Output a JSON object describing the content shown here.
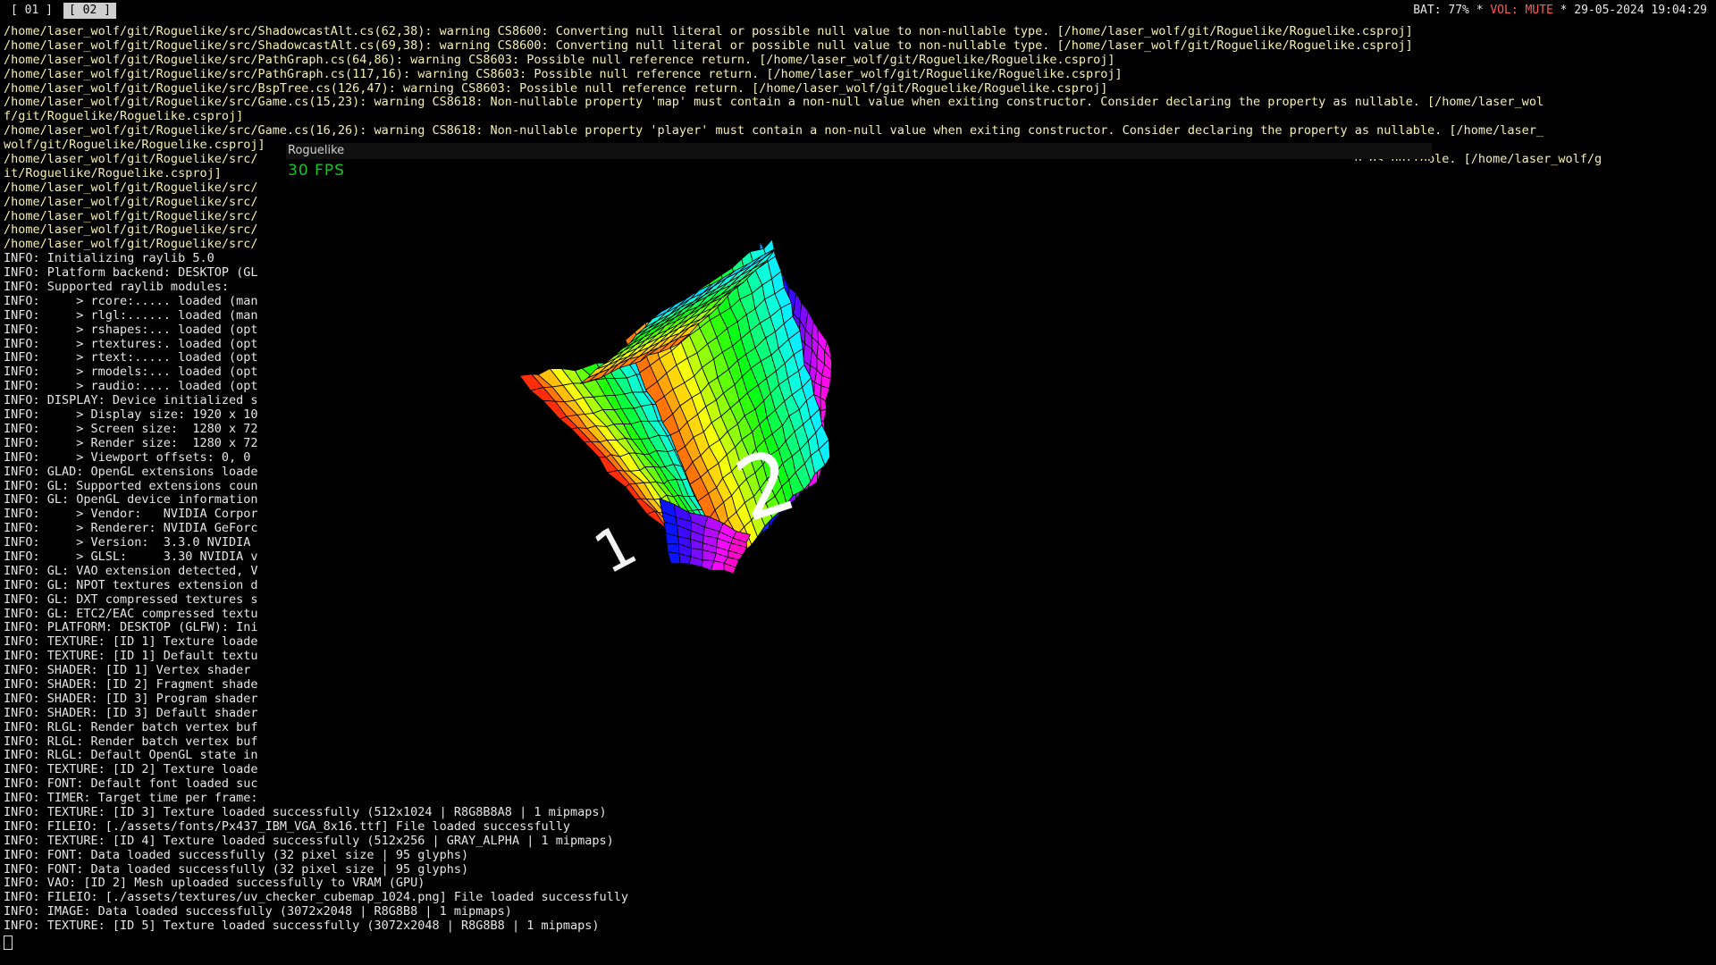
{
  "topbar": {
    "workspaces": [
      "[ 01 ]",
      "[ 02 ]"
    ],
    "battery": "BAT: 77%",
    "sep": "*",
    "volume": "VOL: MUTE",
    "datetime": "29-05-2024 19:04:29"
  },
  "terminal": {
    "lines": [
      "/home/laser_wolf/git/Roguelike/src/ShadowcastAlt.cs(62,38): warning CS8600: Converting null literal or possible null value to non-nullable type. [/home/laser_wolf/git/Roguelike/Roguelike.csproj]",
      "/home/laser_wolf/git/Roguelike/src/ShadowcastAlt.cs(69,38): warning CS8600: Converting null literal or possible null value to non-nullable type. [/home/laser_wolf/git/Roguelike/Roguelike.csproj]",
      "/home/laser_wolf/git/Roguelike/src/PathGraph.cs(64,86): warning CS8603: Possible null reference return. [/home/laser_wolf/git/Roguelike/Roguelike.csproj]",
      "/home/laser_wolf/git/Roguelike/src/PathGraph.cs(117,16): warning CS8603: Possible null reference return. [/home/laser_wolf/git/Roguelike/Roguelike.csproj]",
      "/home/laser_wolf/git/Roguelike/src/BspTree.cs(126,47): warning CS8603: Possible null reference return. [/home/laser_wolf/git/Roguelike/Roguelike.csproj]",
      "/home/laser_wolf/git/Roguelike/src/Game.cs(15,23): warning CS8618: Non-nullable property 'map' must contain a non-null value when exiting constructor. Consider declaring the property as nullable. [/home/laser_wol",
      "f/git/Roguelike/Roguelike.csproj]",
      "/home/laser_wolf/git/Roguelike/src/Game.cs(16,26): warning CS8618: Non-nullable property 'player' must contain a non-null value when exiting constructor. Consider declaring the property as nullable. [/home/laser_",
      "wolf/git/Roguelike/Roguelike.csproj]",
      "/home/laser_wolf/git/Roguelike/src/                                                                                                                                                       d as nullable. [/home/laser_wolf/g",
      "it/Roguelike/Roguelike.csproj]",
      "/home/laser_wolf/git/Roguelike/src/",
      "/home/laser_wolf/git/Roguelike/src/",
      "/home/laser_wolf/git/Roguelike/src/",
      "/home/laser_wolf/git/Roguelike/src/",
      "/home/laser_wolf/git/Roguelike/src/",
      "INFO: Initializing raylib 5.0",
      "INFO: Platform backend: DESKTOP (GL",
      "INFO: Supported raylib modules:",
      "INFO:     > rcore:..... loaded (man",
      "INFO:     > rlgl:...... loaded (man",
      "INFO:     > rshapes:... loaded (opt",
      "INFO:     > rtextures:. loaded (opt",
      "INFO:     > rtext:..... loaded (opt",
      "INFO:     > rmodels:... loaded (opt",
      "INFO:     > raudio:.... loaded (opt",
      "INFO: DISPLAY: Device initialized s",
      "INFO:     > Display size: 1920 x 10",
      "INFO:     > Screen size:  1280 x 72",
      "INFO:     > Render size:  1280 x 72",
      "INFO:     > Viewport offsets: 0, 0",
      "INFO: GLAD: OpenGL extensions loade",
      "INFO: GL: Supported extensions coun",
      "INFO: GL: OpenGL device information",
      "INFO:     > Vendor:   NVIDIA Corpor",
      "INFO:     > Renderer: NVIDIA GeForc",
      "INFO:     > Version:  3.3.0 NVIDIA",
      "INFO:     > GLSL:     3.30 NVIDIA v",
      "INFO: GL: VAO extension detected, V",
      "INFO: GL: NPOT textures extension d",
      "INFO: GL: DXT compressed textures s",
      "INFO: GL: ETC2/EAC compressed textu",
      "INFO: PLATFORM: DESKTOP (GLFW): Ini",
      "INFO: TEXTURE: [ID 1] Texture loade",
      "INFO: TEXTURE: [ID 1] Default textu",
      "INFO: SHADER: [ID 1] Vertex shader",
      "INFO: SHADER: [ID 2] Fragment shade",
      "INFO: SHADER: [ID 3] Program shader",
      "INFO: SHADER: [ID 3] Default shader",
      "INFO: RLGL: Render batch vertex buf",
      "INFO: RLGL: Render batch vertex buf",
      "INFO: RLGL: Default OpenGL state in",
      "INFO: TEXTURE: [ID 2] Texture loade",
      "INFO: FONT: Default font loaded suc",
      "INFO: TIMER: Target time per frame:",
      "INFO: TEXTURE: [ID 3] Texture loaded successfully (512x1024 | R8G8B8A8 | 1 mipmaps)",
      "INFO: FILEIO: [./assets/fonts/Px437_IBM_VGA_8x16.ttf] File loaded successfully",
      "INFO: TEXTURE: [ID 4] Texture loaded successfully (512x256 | GRAY_ALPHA | 1 mipmaps)",
      "INFO: FONT: Data loaded successfully (32 pixel size | 95 glyphs)",
      "INFO: FONT: Data loaded successfully (32 pixel size | 95 glyphs)",
      "INFO: VAO: [ID 2] Mesh uploaded successfully to VRAM (GPU)",
      "INFO: FILEIO: [./assets/textures/uv_checker_cubemap_1024.png] File loaded successfully",
      "INFO: IMAGE: Data loaded successfully (3072x2048 | R8G8B8 | 1 mipmaps)",
      "INFO: TEXTURE: [ID 5] Texture loaded successfully (3072x2048 | R8G8B8 | 1 mipmaps)"
    ]
  },
  "game_window": {
    "title": "Roguelike",
    "fps": "30 FPS",
    "face_labels": [
      "2",
      "1"
    ]
  }
}
